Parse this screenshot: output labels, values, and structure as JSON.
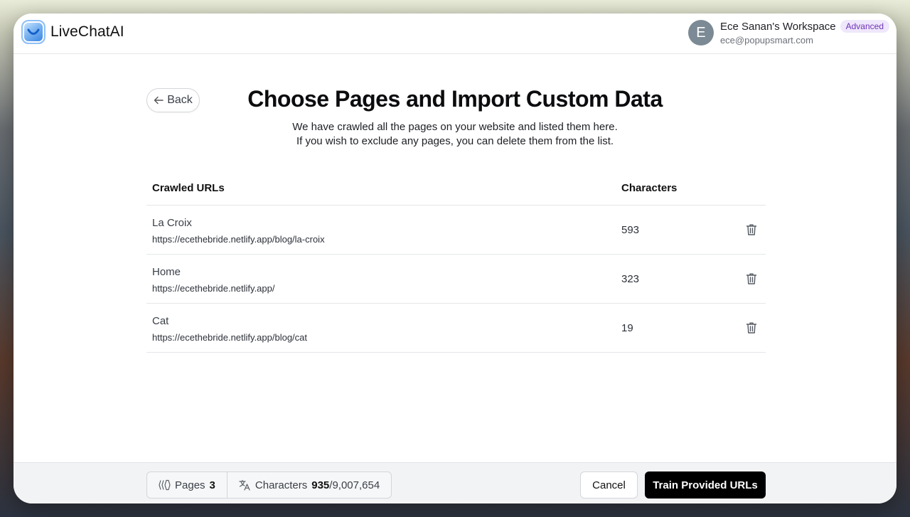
{
  "app": {
    "name": "LiveChatAI"
  },
  "user": {
    "initial": "E",
    "workspace": "Ece Sanan's Workspace",
    "plan_badge": "Advanced",
    "email": "ece@popupsmart.com"
  },
  "page": {
    "back_label": "Back",
    "title": "Choose Pages and Import Custom Data",
    "subtitle_line1": "We have crawled all the pages on your website and listed them here.",
    "subtitle_line2": "If you wish to exclude any pages, you can delete them from the list."
  },
  "table": {
    "columns": {
      "urls": "Crawled URLs",
      "characters": "Characters"
    },
    "rows": [
      {
        "name": "La Croix",
        "url": "https://ecethebride.netlify.app/blog/la-croix",
        "characters": "593"
      },
      {
        "name": "Home",
        "url": "https://ecethebride.netlify.app/",
        "characters": "323"
      },
      {
        "name": "Cat",
        "url": "https://ecethebride.netlify.app/blog/cat",
        "characters": "19"
      }
    ]
  },
  "footer": {
    "pages_label": "Pages",
    "pages_value": "3",
    "characters_label": "Characters",
    "characters_used": "935",
    "characters_limit": "/9,007,654",
    "cancel_label": "Cancel",
    "train_label": "Train Provided URLs"
  },
  "icons": {
    "back": "arrow-left-icon",
    "delete": "trash-icon",
    "pages": "pages-stack-icon",
    "characters": "translate-icon"
  }
}
